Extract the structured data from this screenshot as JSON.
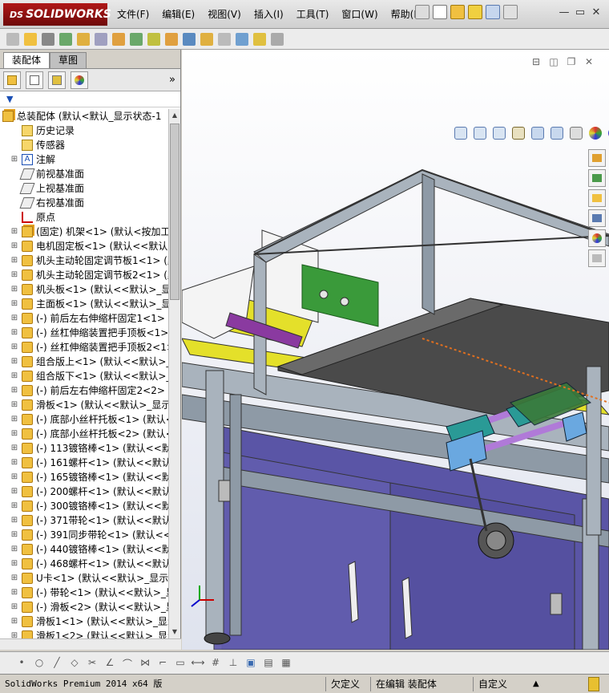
{
  "app": {
    "brand": "SOLIDWORKS",
    "brand_prefix": "DS"
  },
  "menu": [
    "文件(F)",
    "编辑(E)",
    "视图(V)",
    "插入(I)",
    "工具(T)",
    "窗口(W)",
    "帮助(H)"
  ],
  "left_tabs": [
    "装配体",
    "草图"
  ],
  "tree": {
    "root": "总装配体  (默认<默认_显示状态-1",
    "items": [
      {
        "label": "历史记录",
        "icon": "folder"
      },
      {
        "label": "传感器",
        "icon": "folder"
      },
      {
        "label": "注解",
        "icon": "note",
        "expand": true
      },
      {
        "label": "前视基准面",
        "icon": "plane"
      },
      {
        "label": "上视基准面",
        "icon": "plane"
      },
      {
        "label": "右视基准面",
        "icon": "plane"
      },
      {
        "label": "原点",
        "icon": "origin"
      },
      {
        "label": "(固定) 机架<1> (默认<按加工",
        "icon": "asm",
        "expand": true
      },
      {
        "label": "电机固定板<1> (默认<<默认>_显",
        "icon": "part",
        "expand": true
      },
      {
        "label": "机头主动轮固定调节板1<1> (默",
        "icon": "part",
        "expand": true
      },
      {
        "label": "机头主动轮固定调节板2<1> (默",
        "icon": "part",
        "expand": true
      },
      {
        "label": "机头板<1> (默认<<默认>_显示状",
        "icon": "part",
        "expand": true
      },
      {
        "label": "主面板<1> (默认<<默认>_显示状",
        "icon": "part",
        "expand": true
      },
      {
        "label": "(-) 前后左右伸缩杆固定1<1> (",
        "icon": "part",
        "expand": true
      },
      {
        "label": "(-) 丝杠伸缩装置把手顶板<1>",
        "icon": "part",
        "expand": true
      },
      {
        "label": "(-) 丝杠伸缩装置把手顶板2<1>",
        "icon": "part",
        "expand": true
      },
      {
        "label": "组合版上<1> (默认<<默认>_显示",
        "icon": "part",
        "expand": true
      },
      {
        "label": "组合版下<1> (默认<<默认>_显示",
        "icon": "part",
        "expand": true
      },
      {
        "label": "(-) 前后左右伸缩杆固定2<2> (",
        "icon": "part",
        "expand": true
      },
      {
        "label": "滑板<1> (默认<<默认>_显示状态",
        "icon": "part",
        "expand": true
      },
      {
        "label": "(-) 底部小丝杆托板<1> (默认<",
        "icon": "part",
        "expand": true
      },
      {
        "label": "(-) 底部小丝杆托板<2> (默认<",
        "icon": "part",
        "expand": true
      },
      {
        "label": "(-) 113镀铬棒<1> (默认<<默认",
        "icon": "part",
        "expand": true
      },
      {
        "label": "(-) 161螺杆<1> (默认<<默认>_",
        "icon": "part",
        "expand": true
      },
      {
        "label": "(-) 165镀铬棒<1> (默认<<默认",
        "icon": "part",
        "expand": true
      },
      {
        "label": "(-) 200螺杆<1> (默认<<默认>_",
        "icon": "part",
        "expand": true
      },
      {
        "label": "(-) 300镀铬棒<1> (默认<<默认",
        "icon": "part",
        "expand": true
      },
      {
        "label": "(-) 371带轮<1> (默认<<默认>_",
        "icon": "part",
        "expand": true
      },
      {
        "label": "(-) 391同步带轮<1> (默认<<默",
        "icon": "part",
        "expand": true
      },
      {
        "label": "(-) 440镀铬棒<1> (默认<<默认",
        "icon": "part",
        "expand": true
      },
      {
        "label": "(-) 468螺杆<1> (默认<<默认>_",
        "icon": "part",
        "expand": true
      },
      {
        "label": "U卡<1> (默认<<默认>_显示状态",
        "icon": "part",
        "expand": true
      },
      {
        "label": "(-) 带轮<1> (默认<<默认>_显示",
        "icon": "part",
        "expand": true
      },
      {
        "label": "(-) 滑板<2> (默认<<默认>_显示",
        "icon": "part",
        "expand": true
      },
      {
        "label": "滑板1<1> (默认<<默认>_显示状",
        "icon": "part",
        "expand": true
      },
      {
        "label": "滑板1<2> (默认<<默认>_显示状",
        "icon": "part",
        "expand": true
      }
    ]
  },
  "status": {
    "product": "SolidWorks Premium 2014 x64 版",
    "definition": "欠定义",
    "editing": "在编辑 装配体",
    "custom": "自定义",
    "up_arrow": "▲"
  },
  "colors": {
    "brand_red": "#b01818",
    "frame_metal": "#8e9aa6",
    "panel_purple": "#5a55a6",
    "plate_yellow": "#e4e02a",
    "green_plate": "#3a9a3a",
    "teal_block": "#2a9a96",
    "blue_block": "#6aa8e0"
  }
}
